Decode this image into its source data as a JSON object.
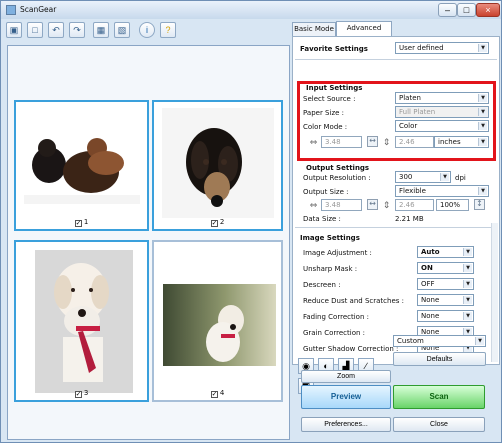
{
  "window": {
    "title": "ScanGear",
    "minimize_label": "–",
    "maximize_label": "□",
    "close_label": "×"
  },
  "toolbar": {
    "icons": [
      "scan-icon",
      "page-icon",
      "rotate-left-icon",
      "rotate-right-icon",
      "thumbnail-icon",
      "whole-image-icon",
      "info-icon",
      "help-icon"
    ],
    "glyphs": [
      "▣",
      "□",
      "↶",
      "↷",
      "▦",
      "▧",
      "i",
      "?"
    ]
  },
  "preview": {
    "thumbnails": [
      {
        "index": "1",
        "checked": true
      },
      {
        "index": "2",
        "checked": true
      },
      {
        "index": "3",
        "checked": true
      },
      {
        "index": "4",
        "checked": true
      }
    ]
  },
  "tabs": {
    "basic": "Basic Mode",
    "advanced": "Advanced Mode"
  },
  "favorite": {
    "label": "Favorite Settings",
    "value": "User defined"
  },
  "input_settings": {
    "title": "Input Settings",
    "select_source_label": "Select Source :",
    "select_source": "Platen",
    "paper_size_label": "Paper Size :",
    "paper_size": "Full Platen",
    "color_mode_label": "Color Mode :",
    "color_mode": "Color",
    "width": "3.48",
    "height": "2.46",
    "unit": "inches"
  },
  "output_settings": {
    "title": "Output Settings",
    "resolution_label": "Output Resolution :",
    "resolution": "300",
    "resolution_unit": "dpi",
    "size_label": "Output Size :",
    "size": "Flexible",
    "width": "3.48",
    "height": "2.46",
    "scale": "100%",
    "data_size_label": "Data Size :",
    "data_size": "2.21 MB"
  },
  "image_settings": {
    "title": "Image Settings",
    "rows": [
      {
        "label": "Image Adjustment :",
        "value": "Auto"
      },
      {
        "label": "Unsharp Mask :",
        "value": "ON"
      },
      {
        "label": "Descreen :",
        "value": "OFF"
      },
      {
        "label": "Reduce Dust and Scratches :",
        "value": "None"
      },
      {
        "label": "Fading Correction :",
        "value": "None"
      },
      {
        "label": "Grain Correction :",
        "value": "None"
      },
      {
        "label": "Gutter Shadow Correction :",
        "value": "None"
      }
    ]
  },
  "color_tools": {
    "custom": "Custom",
    "defaults": "Defaults"
  },
  "buttons": {
    "zoom": "Zoom",
    "preview": "Preview",
    "scan": "Scan",
    "preferences": "Preferences...",
    "close": "Close"
  },
  "colors": {
    "window_bg": "#d8e6f3",
    "accent": "#3aa0dc",
    "highlight": "#e2141b",
    "scan_green": "#69d469"
  }
}
